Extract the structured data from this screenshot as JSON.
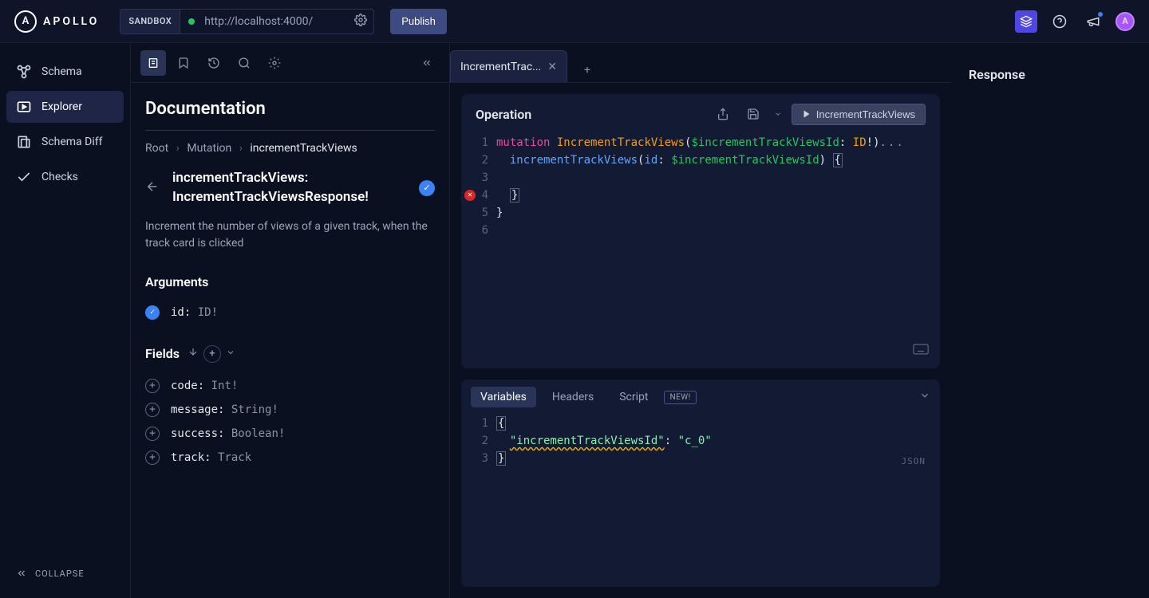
{
  "header": {
    "brand": "APOLLO",
    "sandbox_label": "SANDBOX",
    "url": "http://localhost:4000/",
    "publish_label": "Publish"
  },
  "sidebar": {
    "items": [
      {
        "label": "Schema"
      },
      {
        "label": "Explorer"
      },
      {
        "label": "Schema Diff"
      },
      {
        "label": "Checks"
      }
    ],
    "collapse_label": "COLLAPSE"
  },
  "doc": {
    "title": "Documentation",
    "breadcrumb": {
      "root": "Root",
      "mid": "Mutation",
      "current": "incrementTrackViews"
    },
    "mutation_name": "incrementTrackViews:",
    "mutation_return": "IncrementTrackViewsResponse!",
    "description": "Increment the number of views of a given track, when the track card is clicked",
    "arguments_title": "Arguments",
    "args": [
      {
        "name": "id:",
        "type": "ID!"
      }
    ],
    "fields_title": "Fields",
    "fields": [
      {
        "name": "code:",
        "type": "Int!"
      },
      {
        "name": "message:",
        "type": "String!"
      },
      {
        "name": "success:",
        "type": "Boolean!"
      },
      {
        "name": "track:",
        "type": "Track"
      }
    ]
  },
  "tabs": {
    "active": "IncrementTrac..."
  },
  "operation": {
    "title": "Operation",
    "run_label": "IncrementTrackViews",
    "code": {
      "line1_kw": "mutation",
      "line1_name": "IncrementTrackViews",
      "line1_var": "$incrementTrackViewsId",
      "line1_colon": ":",
      "line1_type": "ID",
      "line1_bang_paren": "!)",
      "line1_ellipsis": "...",
      "line2_field": "incrementTrackViews",
      "line2_argname": "id",
      "line2_colon": ":",
      "line2_var": "$incrementTrackViewsId",
      "line2_paren_brace": ")",
      "line2_brace": "{",
      "line4_brace": "}",
      "line5_brace": "}"
    }
  },
  "vars": {
    "tabs": [
      {
        "label": "Variables"
      },
      {
        "label": "Headers"
      },
      {
        "label": "Script"
      }
    ],
    "new_label": "NEW!",
    "json_label": "JSON",
    "json": {
      "open": "{",
      "key": "\"incrementTrackViewsId\"",
      "colon": ":",
      "val": "\"c_0\"",
      "close": "}"
    }
  },
  "response": {
    "title": "Response"
  }
}
